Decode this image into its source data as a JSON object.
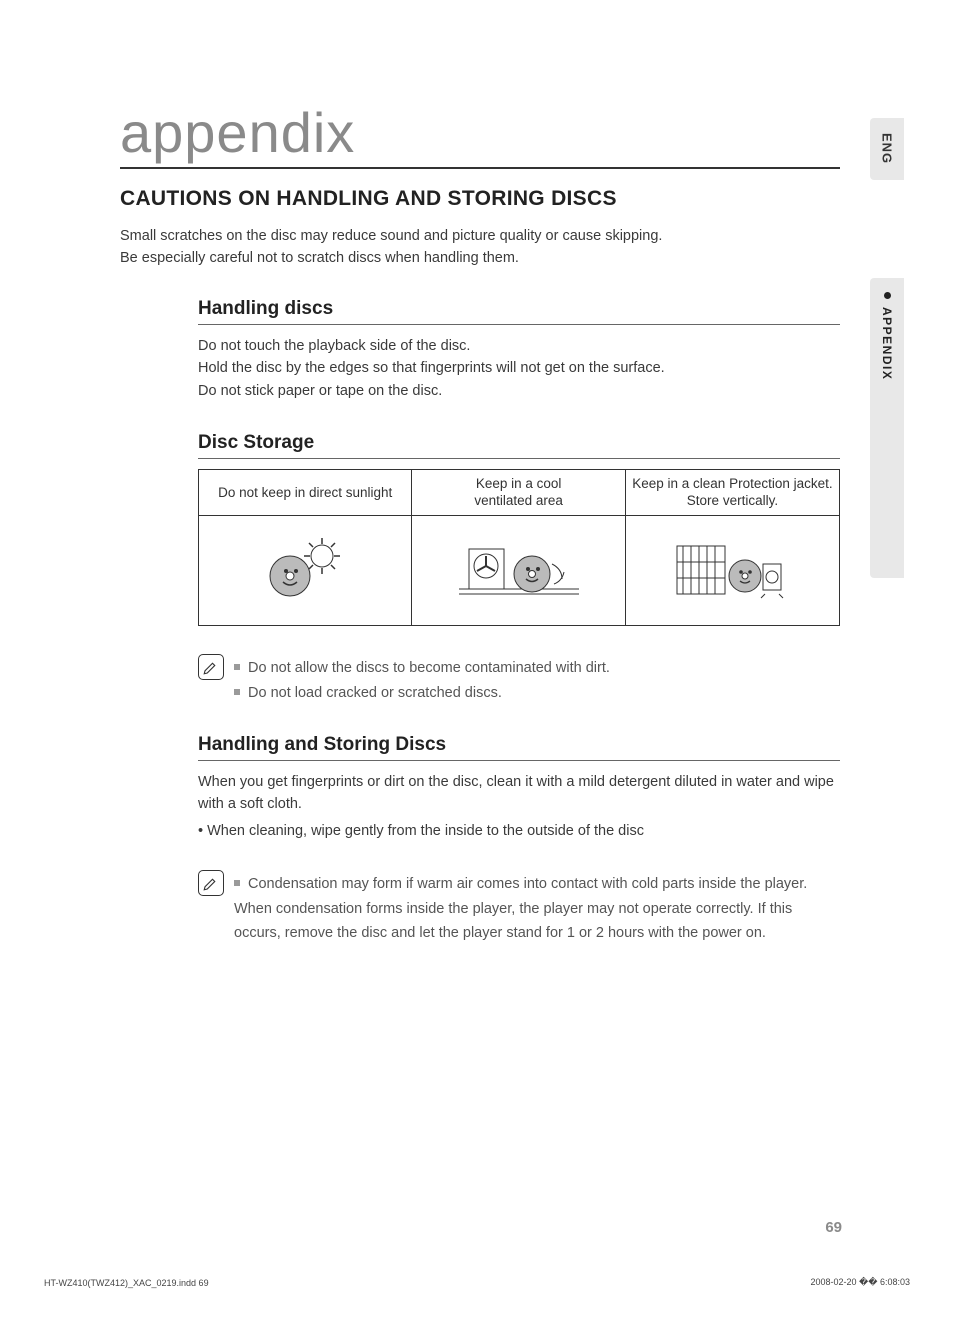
{
  "title": "appendix",
  "h1": "CAUTIONS ON HANDLING AND STORING DISCS",
  "intro": {
    "l1": "Small scratches on the disc may reduce sound and picture quality or cause skipping.",
    "l2": "Be especially careful not to scratch discs when handling them."
  },
  "handling": {
    "heading": "Handling discs",
    "l1": "Do not touch the playback side of the disc.",
    "l2": "Hold the disc by the edges so that fingerprints will not get on the surface.",
    "l3": "Do not stick paper or tape on the disc."
  },
  "storage": {
    "heading": "Disc Storage",
    "cols": {
      "0": "Do not keep in direct sunlight",
      "1a": "Keep in a cool",
      "1b": "ventilated area",
      "2a": "Keep in a clean Protection jacket.",
      "2b": "Store vertically."
    }
  },
  "notes1": [
    "Do not allow the discs to become contaminated with dirt.",
    "Do not load cracked or scratched discs."
  ],
  "handstore": {
    "heading": "Handling and Storing Discs",
    "p1": "When you get fingerprints or dirt on the disc, clean it with a mild detergent diluted in water and wipe with a soft cloth.",
    "b1": "When cleaning, wipe gently from the inside to the outside of the disc"
  },
  "notes2": [
    "Condensation may form if warm air comes into contact with cold parts inside the player. When condensation forms inside the player, the player may not operate correctly. If this occurs, remove the disc and let the player stand for 1 or 2 hours with the power on."
  ],
  "sidebar": {
    "eng": "ENG",
    "appendix": "APPENDIX"
  },
  "pagenum": "69",
  "footer": {
    "left": "HT-WZ410(TWZ412)_XAC_0219.indd   69",
    "right": "2008-02-20   �� 6:08:03"
  }
}
